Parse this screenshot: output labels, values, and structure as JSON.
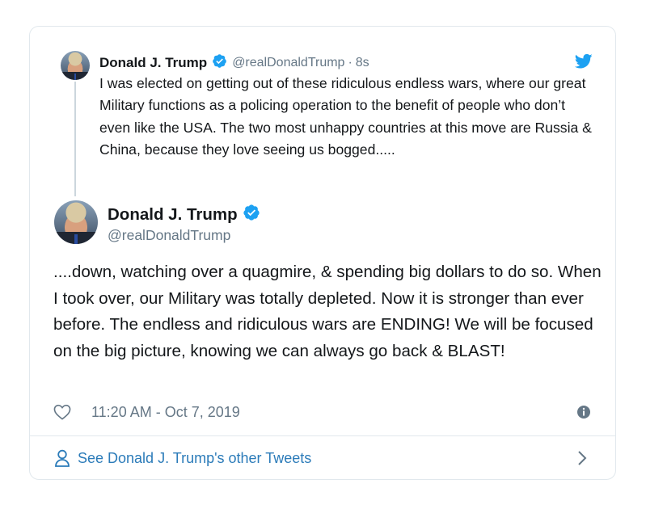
{
  "quoted_tweet": {
    "author_name": "Donald J. Trump",
    "handle": "@realDonaldTrump",
    "separator": "·",
    "time_ago": "8s",
    "text": "I was elected on getting out of these ridiculous endless wars, where our great Military functions as a policing operation to the benefit of people who don’t even like the USA. The two most unhappy countries at this move are Russia & China, because they love seeing us bogged....."
  },
  "main_tweet": {
    "author_name": "Donald J. Trump",
    "handle": "@realDonaldTrump",
    "text": "....down, watching over a quagmire, & spending big dollars to do so. When I took over, our Military was totally depleted. Now it is stronger than ever before. The endless and ridiculous wars are ENDING! We will be focused on the big picture, knowing we can always go back & BLAST!",
    "timestamp": "11:20 AM - Oct 7, 2019"
  },
  "footer": {
    "see_more_label": "See Donald J. Trump's other Tweets"
  },
  "colors": {
    "verified_blue": "#1da1f2",
    "link_blue": "#2b7bb9",
    "secondary_text": "#657786",
    "border": "#e1e8ed"
  },
  "icons": [
    "verified-badge-icon",
    "twitter-bird-icon",
    "heart-icon",
    "info-icon",
    "person-icon",
    "chevron-right-icon"
  ]
}
